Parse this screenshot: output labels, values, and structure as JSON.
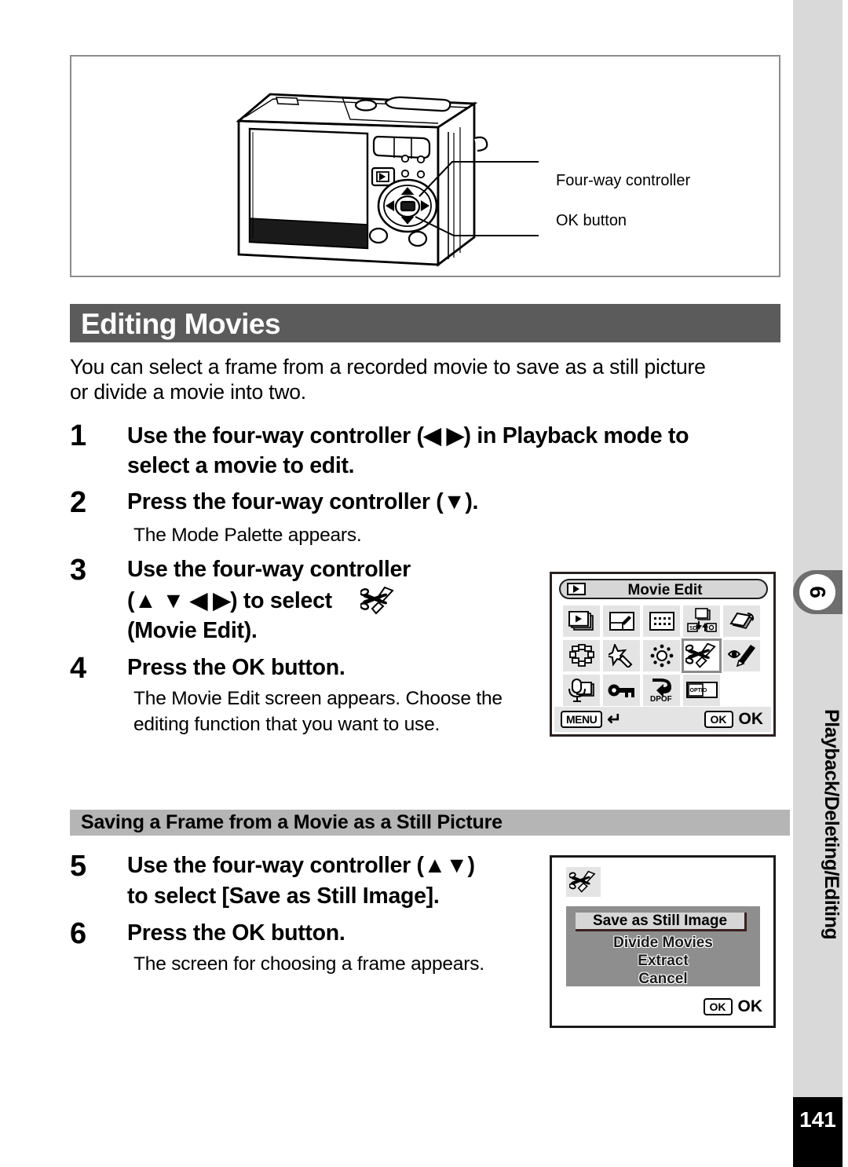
{
  "page": {
    "number": "141"
  },
  "chapter_tab": {
    "number": "6",
    "label": "Playback/Deleting/Editing"
  },
  "illustration": {
    "callouts": [
      {
        "name": "four-way-controller",
        "label": "Four-way controller"
      },
      {
        "name": "ok-button",
        "label": "OK button"
      }
    ]
  },
  "section": {
    "heading": "Editing Movies",
    "intro_line_1": "You can select a frame from a recorded movie to save as a still picture",
    "intro_line_2": "or divide a movie into two."
  },
  "steps": [
    {
      "number": "1",
      "line1": "Use the four-way controller (◀ ▶) in Playback mode to",
      "line2": "select a movie to edit."
    },
    {
      "number": "2",
      "line1": "Press the four-way controller (▼).",
      "note": "The Mode Palette appears."
    },
    {
      "number": "3",
      "line1": "Use the four-way controller",
      "line2": "(▲ ▼ ◀ ▶) to select",
      "line3": "(Movie Edit)."
    },
    {
      "number": "4",
      "line1": "Press the OK button.",
      "note1": "The Movie Edit screen appears. Choose the",
      "note2": "editing function that you want to use."
    },
    {
      "number": "5",
      "line1": "Use the four-way controller (▲▼)",
      "line2": "to select [Save as Still Image]."
    },
    {
      "number": "6",
      "line1": "Press the OK button.",
      "note": "The screen for choosing a frame appears."
    }
  ],
  "subsection": {
    "heading": "Saving a Frame from a Movie as a Still Picture"
  },
  "movie_edit_screen": {
    "title": "Movie Edit",
    "play_icon": "playback-icon",
    "icons": [
      {
        "name": "slideshow-icon",
        "row": 1,
        "col": 1,
        "selected": false
      },
      {
        "name": "resize-icon",
        "row": 1,
        "col": 2,
        "selected": false
      },
      {
        "name": "cropping-icon",
        "row": 1,
        "col": 3,
        "selected": false
      },
      {
        "name": "image-copy-icon",
        "row": 1,
        "col": 4,
        "selected": false
      },
      {
        "name": "image-rotate-icon",
        "row": 1,
        "col": 5,
        "selected": false
      },
      {
        "name": "frame-composite-icon",
        "row": 2,
        "col": 1,
        "selected": false
      },
      {
        "name": "digital-filter-icon",
        "row": 2,
        "col": 2,
        "selected": false
      },
      {
        "name": "brightness-filter-icon",
        "row": 2,
        "col": 3,
        "selected": false
      },
      {
        "name": "movie-edit-icon",
        "row": 2,
        "col": 4,
        "selected": true
      },
      {
        "name": "red-eye-edit-icon",
        "row": 2,
        "col": 5,
        "selected": false
      },
      {
        "name": "voice-memo-icon",
        "row": 3,
        "col": 1,
        "selected": false
      },
      {
        "name": "protect-key-icon",
        "row": 3,
        "col": 2,
        "selected": false
      },
      {
        "name": "dpof-icon",
        "row": 3,
        "col": 3,
        "selected": false
      },
      {
        "name": "start-up-screen-icon",
        "row": 3,
        "col": 4,
        "selected": false
      }
    ],
    "footer": {
      "menu_chip": "MENU",
      "back_icon": "back-arrow-icon",
      "ok_chip": "OK",
      "ok_label": "OK"
    }
  },
  "still_image_screen": {
    "header_icon": "movie-edit-icon",
    "selected_option": "Save as Still Image",
    "options": [
      "Divide Movies",
      "Extract",
      "Cancel"
    ],
    "footer": {
      "ok_chip": "OK",
      "ok_label": "OK"
    }
  },
  "colors": {
    "section_heading_bg": "#5b5b5b",
    "subsection_heading_bg": "#b5b5b5",
    "sidebar_bg": "#d9d9d9",
    "chapter_tab_bg": "#6e6e6e",
    "page_number_bg": "#000000",
    "palette_cell_bg": "#e4e4e4",
    "menu_panel_bg": "#8e8e8e"
  }
}
